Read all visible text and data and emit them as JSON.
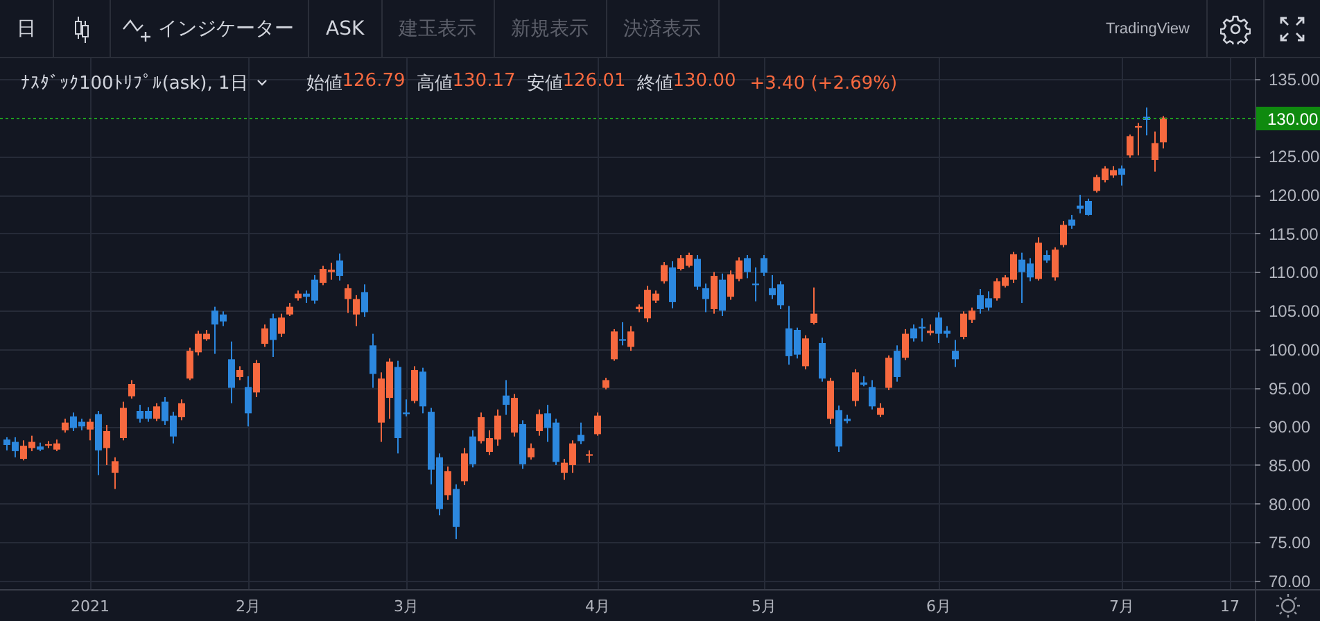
{
  "toolbar": {
    "interval": "日",
    "indicators": "インジケーター",
    "buttons": [
      {
        "label": "ASK",
        "disabled": false
      },
      {
        "label": "建玉表示",
        "disabled": true
      },
      {
        "label": "新規表示",
        "disabled": true
      },
      {
        "label": "決済表示",
        "disabled": true
      }
    ],
    "brand": "TradingView"
  },
  "legend": {
    "symbol": "ﾅｽﾀﾞｯｸ100ﾄﾘﾌﾟﾙ(ask), 1日",
    "values": [
      {
        "label": "始値",
        "value": "126.79"
      },
      {
        "label": "高値",
        "value": "130.17"
      },
      {
        "label": "安値",
        "value": "126.01"
      },
      {
        "label": "終値",
        "value": "130.00"
      }
    ],
    "change": "+3.40 (+2.69%)"
  },
  "chart": {
    "chart_data": {
      "type": "candlestick",
      "grid": true,
      "ylim": [
        68.93,
        137.69
      ],
      "yticks": [
        {
          "value": 70,
          "label": "70.00"
        },
        {
          "value": 75,
          "label": "75.00"
        },
        {
          "value": 80,
          "label": "80.00"
        },
        {
          "value": 85,
          "label": "85.00"
        },
        {
          "value": 90,
          "label": "90.00"
        },
        {
          "value": 95,
          "label": "95.00"
        },
        {
          "value": 100,
          "label": "100.00"
        },
        {
          "value": 105,
          "label": "105.00"
        },
        {
          "value": 110,
          "label": "110.00"
        },
        {
          "value": 115,
          "label": "115.00"
        },
        {
          "value": 120,
          "label": "120.00"
        },
        {
          "value": 125,
          "label": "125.00"
        },
        {
          "value": 135,
          "label": "135.00"
        }
      ],
      "categories": [
        null,
        null,
        null,
        null,
        null,
        null,
        null,
        null,
        null,
        null,
        "2021",
        null,
        null,
        null,
        null,
        null,
        null,
        null,
        null,
        null,
        null,
        null,
        null,
        null,
        null,
        null,
        null,
        null,
        null,
        "2月",
        null,
        null,
        null,
        null,
        null,
        null,
        null,
        null,
        null,
        null,
        null,
        null,
        null,
        null,
        null,
        null,
        null,
        null,
        "3月",
        null,
        null,
        null,
        null,
        null,
        null,
        null,
        null,
        null,
        null,
        null,
        null,
        null,
        null,
        null,
        null,
        null,
        null,
        null,
        null,
        null,
        null,
        "4月",
        null,
        null,
        null,
        null,
        null,
        null,
        null,
        null,
        null,
        null,
        null,
        null,
        null,
        null,
        null,
        null,
        null,
        null,
        null,
        "5月",
        null,
        null,
        null,
        null,
        null,
        null,
        null,
        null,
        null,
        null,
        null,
        null,
        null,
        null,
        null,
        null,
        null,
        null,
        null,
        null,
        "6月",
        null,
        null,
        null,
        null,
        null,
        null,
        null,
        null,
        null,
        null,
        null,
        null,
        null,
        null,
        null,
        null,
        null,
        null,
        null,
        null,
        null,
        "7月",
        null,
        null,
        null,
        null,
        null,
        null,
        null,
        null,
        null,
        null,
        null,
        null,
        "17"
      ],
      "ohlc": [
        [
          88.3,
          88.6,
          86.9,
          87.6
        ],
        [
          88.0,
          88.6,
          86.0,
          86.8
        ],
        [
          85.8,
          88.2,
          85.6,
          87.5
        ],
        [
          87.2,
          88.8,
          86.8,
          88.0
        ],
        [
          87.4,
          87.9,
          86.8,
          87.0
        ],
        [
          87.6,
          88.1,
          87.2,
          87.7
        ],
        [
          87.0,
          88.3,
          86.8,
          87.8
        ],
        [
          89.5,
          91.0,
          89.2,
          90.5
        ],
        [
          91.3,
          91.8,
          89.4,
          89.8
        ],
        [
          90.6,
          91.0,
          89.5,
          90.0
        ],
        [
          89.6,
          91.0,
          88.2,
          90.6
        ],
        [
          91.6,
          92.0,
          83.7,
          86.9
        ],
        [
          87.2,
          90.2,
          85.0,
          89.4
        ],
        [
          84.0,
          86.0,
          81.9,
          85.5
        ],
        [
          88.5,
          93.2,
          88.2,
          92.4
        ],
        [
          93.9,
          96.0,
          93.6,
          95.5
        ],
        [
          92.0,
          92.8,
          90.5,
          91.0
        ],
        [
          92.0,
          92.5,
          90.6,
          91.0
        ],
        [
          91.0,
          93.0,
          90.7,
          92.6
        ],
        [
          93.2,
          93.8,
          90.2,
          90.7
        ],
        [
          91.4,
          91.9,
          87.8,
          88.7
        ],
        [
          91.2,
          93.5,
          90.8,
          93.0
        ],
        [
          96.2,
          100.2,
          96.0,
          99.8
        ],
        [
          99.6,
          102.4,
          99.2,
          102.0
        ],
        [
          101.3,
          102.5,
          101.1,
          102.0
        ],
        [
          105.0,
          105.5,
          99.4,
          103.2
        ],
        [
          104.5,
          104.9,
          103.0,
          103.6
        ],
        [
          98.7,
          101.0,
          93.0,
          95.0
        ],
        [
          96.4,
          97.8,
          96.0,
          97.3
        ],
        [
          95.1,
          96.5,
          90.0,
          91.7
        ],
        [
          94.4,
          98.6,
          93.8,
          98.2
        ],
        [
          100.7,
          103.2,
          100.3,
          102.7
        ],
        [
          104.0,
          104.6,
          99.0,
          101.2
        ],
        [
          102.0,
          104.6,
          101.6,
          104.1
        ],
        [
          104.5,
          106.0,
          104.3,
          105.5
        ],
        [
          106.6,
          107.6,
          106.3,
          107.2
        ],
        [
          107.2,
          107.6,
          106.0,
          106.8
        ],
        [
          109.0,
          109.6,
          105.9,
          106.3
        ],
        [
          108.6,
          110.8,
          108.3,
          110.4
        ],
        [
          110.0,
          111.2,
          109.0,
          110.3
        ],
        [
          111.5,
          112.4,
          108.9,
          109.5
        ],
        [
          106.5,
          108.4,
          104.7,
          107.9
        ],
        [
          104.5,
          107.0,
          103.0,
          106.5
        ],
        [
          107.4,
          108.4,
          104.2,
          104.8
        ],
        [
          100.5,
          102.0,
          95.0,
          96.8
        ],
        [
          90.5,
          97.0,
          88.0,
          96.2
        ],
        [
          93.7,
          98.8,
          91.0,
          98.4
        ],
        [
          97.7,
          98.5,
          86.5,
          88.5
        ],
        [
          91.8,
          93.5,
          91.3,
          91.6
        ],
        [
          93.3,
          97.8,
          93.0,
          97.3
        ],
        [
          97.1,
          97.6,
          91.7,
          92.6
        ],
        [
          91.9,
          92.4,
          82.5,
          84.4
        ],
        [
          86.0,
          86.5,
          78.5,
          79.3
        ],
        [
          81.1,
          84.8,
          80.5,
          84.2
        ],
        [
          81.9,
          82.5,
          75.4,
          77.0
        ],
        [
          82.9,
          87.2,
          82.4,
          86.5
        ],
        [
          88.7,
          89.5,
          84.7,
          85.1
        ],
        [
          88.1,
          91.8,
          87.8,
          91.2
        ],
        [
          86.7,
          89.5,
          86.3,
          88.5
        ],
        [
          88.3,
          92.2,
          87.5,
          91.4
        ],
        [
          94.0,
          96.0,
          91.5,
          92.8
        ],
        [
          89.2,
          94.2,
          88.7,
          93.7
        ],
        [
          90.3,
          90.8,
          84.5,
          85.1
        ],
        [
          86.0,
          87.8,
          85.7,
          87.2
        ],
        [
          89.4,
          92.2,
          88.8,
          91.6
        ],
        [
          91.7,
          92.8,
          88.0,
          89.8
        ],
        [
          90.5,
          91.0,
          85.0,
          85.4
        ],
        [
          84.0,
          85.8,
          83.1,
          85.3
        ],
        [
          85.0,
          88.2,
          84.0,
          87.8
        ],
        [
          88.9,
          90.5,
          87.7,
          88.1
        ],
        [
          86.2,
          86.9,
          85.3,
          86.4
        ],
        [
          89.0,
          91.8,
          88.8,
          91.4
        ],
        [
          95.0,
          96.3,
          94.8,
          96.0
        ],
        [
          98.7,
          102.6,
          98.5,
          102.3
        ],
        [
          101.3,
          103.5,
          100.5,
          101.1
        ],
        [
          100.3,
          103.0,
          99.8,
          102.3
        ],
        [
          105.2,
          105.8,
          104.8,
          105.5
        ],
        [
          104.0,
          108.2,
          103.5,
          107.7
        ],
        [
          106.3,
          107.6,
          106.0,
          107.2
        ],
        [
          108.8,
          111.3,
          108.5,
          110.9
        ],
        [
          110.6,
          111.4,
          105.3,
          106.1
        ],
        [
          110.4,
          112.2,
          110.2,
          111.8
        ],
        [
          110.8,
          112.5,
          110.6,
          112.2
        ],
        [
          111.7,
          112.2,
          107.7,
          108.1
        ],
        [
          107.9,
          108.5,
          104.8,
          106.5
        ],
        [
          105.2,
          110.0,
          104.6,
          109.5
        ],
        [
          109.0,
          109.8,
          104.3,
          105.0
        ],
        [
          106.8,
          110.2,
          106.4,
          109.7
        ],
        [
          109.1,
          111.9,
          108.8,
          111.5
        ],
        [
          111.8,
          112.2,
          109.2,
          110.0
        ],
        [
          108.5,
          110.6,
          106.2,
          108.3
        ],
        [
          111.8,
          112.2,
          109.5,
          109.9
        ],
        [
          107.9,
          109.6,
          106.5,
          107.0
        ],
        [
          108.4,
          108.8,
          105.2,
          105.7
        ],
        [
          102.7,
          105.6,
          98.0,
          99.1
        ],
        [
          102.5,
          102.8,
          98.8,
          99.3
        ],
        [
          97.8,
          101.8,
          97.4,
          101.4
        ],
        [
          103.4,
          108.0,
          103.2,
          104.6
        ],
        [
          100.8,
          101.5,
          95.8,
          96.2
        ],
        [
          91.0,
          96.3,
          90.3,
          95.9
        ],
        [
          92.1,
          92.7,
          86.7,
          87.4
        ],
        [
          91.0,
          91.5,
          90.4,
          90.7
        ],
        [
          93.3,
          97.4,
          92.6,
          97.0
        ],
        [
          95.7,
          96.5,
          95.2,
          95.4
        ],
        [
          95.1,
          96.0,
          92.2,
          92.6
        ],
        [
          91.5,
          93.0,
          91.2,
          92.4
        ],
        [
          95.0,
          99.2,
          94.7,
          98.9
        ],
        [
          99.8,
          100.5,
          95.8,
          96.4
        ],
        [
          98.9,
          102.6,
          98.6,
          102.0
        ],
        [
          102.7,
          103.2,
          101.0,
          101.4
        ],
        [
          102.9,
          104.0,
          101.0,
          102.7
        ],
        [
          102.1,
          103.2,
          101.8,
          102.4
        ],
        [
          104.1,
          104.8,
          100.8,
          102.0
        ],
        [
          102.4,
          103.0,
          101.5,
          102.0
        ],
        [
          99.8,
          101.2,
          97.7,
          98.7
        ],
        [
          101.6,
          104.9,
          101.3,
          104.6
        ],
        [
          103.8,
          105.4,
          103.4,
          105.0
        ],
        [
          107.0,
          107.8,
          104.6,
          105.2
        ],
        [
          106.6,
          107.5,
          105.0,
          105.4
        ],
        [
          106.6,
          109.2,
          106.3,
          108.8
        ],
        [
          108.2,
          109.6,
          108.0,
          109.3
        ],
        [
          109.0,
          112.6,
          108.6,
          112.3
        ],
        [
          111.6,
          112.5,
          106.0,
          110.0
        ],
        [
          111.1,
          111.8,
          108.8,
          109.3
        ],
        [
          109.1,
          114.5,
          108.9,
          113.8
        ],
        [
          112.2,
          112.8,
          111.2,
          111.5
        ],
        [
          109.3,
          113.2,
          108.9,
          112.9
        ],
        [
          113.5,
          116.6,
          113.2,
          116.1
        ],
        [
          116.8,
          117.4,
          115.6,
          116.0
        ],
        [
          118.6,
          120.0,
          117.6,
          118.2
        ],
        [
          119.2,
          119.5,
          117.3,
          117.4
        ],
        [
          120.5,
          122.6,
          120.3,
          122.3
        ],
        [
          121.9,
          123.7,
          121.6,
          123.4
        ],
        [
          122.5,
          123.7,
          122.2,
          123.2
        ],
        [
          123.4,
          123.8,
          121.2,
          122.6
        ],
        [
          125.1,
          127.8,
          124.8,
          127.6
        ],
        [
          128.7,
          129.3,
          125.1,
          128.9
        ],
        [
          130.1,
          131.3,
          127.7,
          129.7
        ],
        [
          124.5,
          128.2,
          123.0,
          126.7
        ],
        [
          126.8,
          130.2,
          126.0,
          130.0
        ],
        null,
        null,
        null,
        null,
        null,
        null,
        null,
        null
      ],
      "ref_lines": [
        {
          "axis": "y",
          "value": 130,
          "label": "130.00"
        }
      ]
    }
  }
}
